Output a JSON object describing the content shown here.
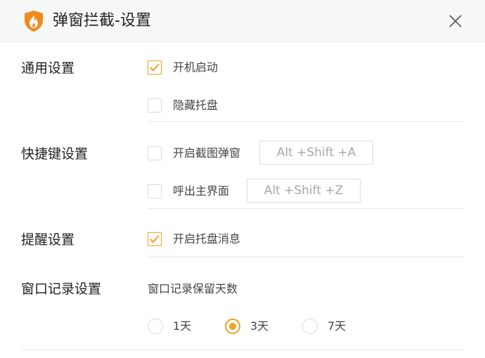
{
  "window": {
    "title": "弹窗拦截-设置",
    "logo_icon": "flame-shield-icon",
    "close_icon": "close-icon"
  },
  "colors": {
    "accent": "#f0a023",
    "logo_orange": "#f08a1c"
  },
  "general": {
    "title": "通用设置",
    "options": [
      {
        "label": "开机启动",
        "checked": true
      },
      {
        "label": "隐藏托盘",
        "checked": false
      }
    ]
  },
  "hotkeys": {
    "title": "快捷键设置",
    "items": [
      {
        "label": "开启截图弹窗",
        "checked": false,
        "shortcut": "Alt +Shift +A"
      },
      {
        "label": "呼出主界面",
        "checked": false,
        "shortcut": "Alt +Shift +Z"
      }
    ]
  },
  "reminder": {
    "title": "提醒设置",
    "options": [
      {
        "label": "开启托盘消息",
        "checked": true
      }
    ]
  },
  "history": {
    "title": "窗口记录设置",
    "subtitle": "窗口记录保留天数",
    "options": [
      {
        "label": "1天",
        "selected": false
      },
      {
        "label": "3天",
        "selected": true
      },
      {
        "label": "7天",
        "selected": false
      }
    ]
  }
}
